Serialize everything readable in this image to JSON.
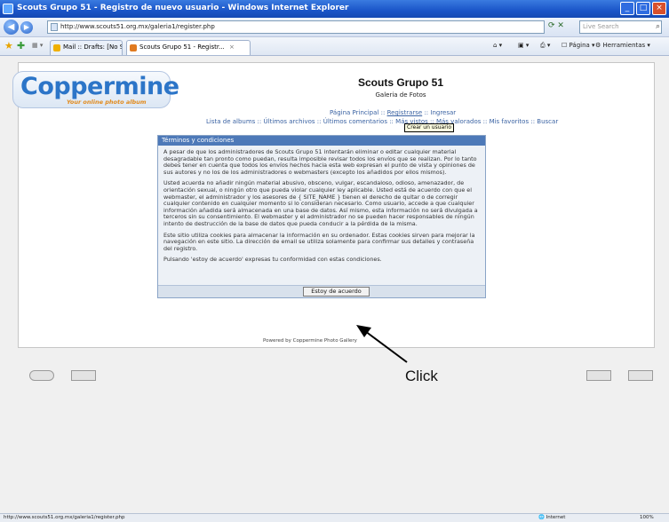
{
  "window": {
    "title": "Scouts Grupo 51 - Registro de nuevo usuario - Windows Internet Explorer",
    "minimize": "_",
    "maximize": "□",
    "close": "×"
  },
  "address": {
    "url": "http://www.scouts51.org.mx/galeria1/register.php",
    "search_placeholder": "Live Search"
  },
  "tabs": [
    {
      "label": "Mail :: Drafts: [No Subject]"
    },
    {
      "label": "Scouts Grupo 51 - Registr..."
    }
  ],
  "commands": {
    "page": "Página",
    "tools": "Herramientas"
  },
  "logo": {
    "word": "Coppermine",
    "tagline": "Your online photo album"
  },
  "gallery": {
    "title": "Scouts Grupo 51",
    "description": "Galeria de Fotos"
  },
  "nav": {
    "line1": [
      "Página Principal",
      "Registrarse",
      "Ingresar"
    ],
    "line2": [
      "Lista de albums",
      "Últimos archivos",
      "Últimos comentarios",
      "Más vistos",
      "Más valorados",
      "Mis favoritos",
      "Buscar"
    ],
    "separator": "::"
  },
  "tooltip": "Crear un usuario",
  "terms": {
    "header": "Términos y condiciones",
    "paragraphs": [
      "A pesar de que los administradores de Scouts Grupo 51 intentarán eliminar o editar cualquier material desagradable tan pronto como puedan, resulta imposible revisar todos los envíos que se realizan. Por lo tanto debes tener en cuenta que todos los envíos hechos hacia esta web expresan el punto de vista y opiniones de sus autores y no los de los administradores o webmasters (excepto los añadidos por ellos mismos).",
      "Usted acuerda no añadir ningún material abusivo, obsceno, vulgar, escandaloso, odioso, amenazador, de orientación sexual, o ningún otro que pueda violar cualquier ley aplicable. Usted está de acuerdo con que el webmaster, el administrador y los asesores de { SITE_NAME } tienen el derecho de quitar o de corregir cualquier contenido en cualquier momento si lo consideran necesario. Como usuario, accede a que cualquier información añadida será almacenada en una base de datos. Así mismo, esta información no será divulgada a terceros sin su consentimiento. El webmaster y el administrador no se pueden hacer responsables de ningún intento de destrucción de la base de datos que pueda conducir a la pérdida de la misma.",
      "Este sitio utiliza cookies para almacenar la información en su ordenador. Estas cookies sirven para mejorar la navegación en este sitio. La dirección de email se utiliza solamente para confirmar sus detalles y contraseña del registro.",
      "Pulsando 'estoy de acuerdo' expresas tu conformidad con estas condiciones."
    ],
    "agree_button": "Estoy de acuerdo"
  },
  "powered_by": "Powered by Coppermine Photo Gallery",
  "annotation": "Click",
  "status": {
    "url": "http://www.scouts51.org.mx/galeria1/register.php",
    "zone": "Internet",
    "zoom": "100%"
  }
}
